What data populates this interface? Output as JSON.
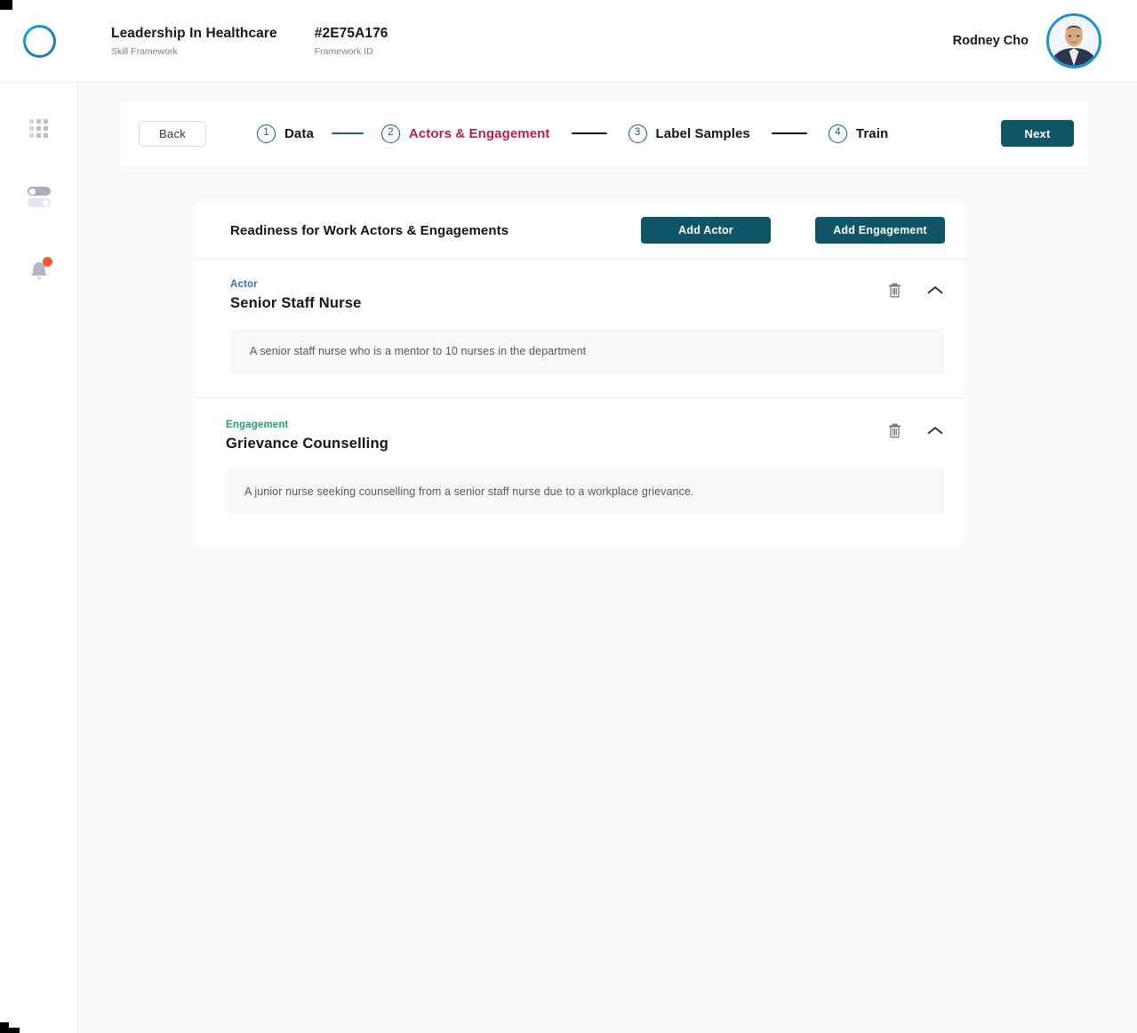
{
  "header": {
    "logo_icon": "ring-logo-icon",
    "framework": {
      "title": "Leadership In Healthcare",
      "subtitle": "Skill Framework"
    },
    "framework_id": {
      "title": "#2E75A176",
      "subtitle": "Framework ID"
    },
    "user": {
      "name": "Rodney Cho",
      "avatar_icon": "user-avatar"
    }
  },
  "sidebar": {
    "items": [
      {
        "name": "apps-grid-icon",
        "label": "Apps"
      },
      {
        "name": "toggles-icon",
        "label": "Settings"
      },
      {
        "name": "bell-icon",
        "label": "Notifications",
        "badge": true
      }
    ]
  },
  "stepper": {
    "back_label": "Back",
    "next_label": "Next",
    "steps": [
      {
        "number": "1",
        "label": "Data",
        "state": "done"
      },
      {
        "number": "2",
        "label": "Actors & Engagement",
        "state": "active"
      },
      {
        "number": "3",
        "label": "Label Samples",
        "state": "upcoming"
      },
      {
        "number": "4",
        "label": "Train",
        "state": "upcoming"
      }
    ]
  },
  "card": {
    "title": "Readiness for Work Actors & Engagements",
    "add_actor_label": "Add Actor",
    "add_engagement_label": "Add Engagement",
    "actor": {
      "kicker": "Actor",
      "name": "Senior Staff Nurse",
      "description": "A senior staff nurse who is a mentor to 10 nurses in the department",
      "delete_icon": "trash-icon",
      "collapse_icon": "chevron-up-icon"
    },
    "engagement": {
      "kicker": "Engagement",
      "name": "Grievance Counselling",
      "description": "A junior nurse seeking counselling from a senior staff nurse due to a workplace grievance.",
      "delete_icon": "trash-icon",
      "collapse_icon": "chevron-up-icon"
    }
  },
  "colors": {
    "brand_teal": "#0f5568",
    "step_active": "#b51e55",
    "actor_blue": "#2f72b6",
    "engagement_green": "#22a06b",
    "badge_red": "#f3572d",
    "logo_blue": "#1b93cf",
    "canvas_bg": "#f9fafc"
  }
}
